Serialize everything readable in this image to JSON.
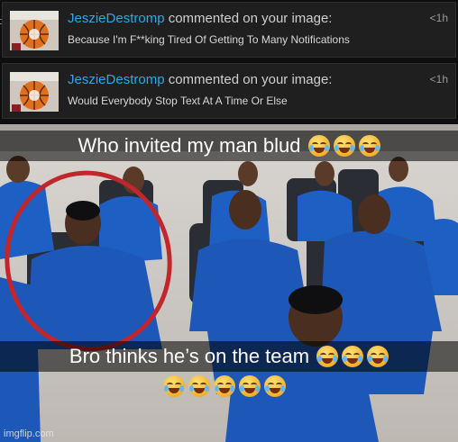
{
  "notifications": [
    {
      "username": "JeszieDestromp",
      "action": " commented on your image:",
      "comment": "Because I'm F**king Tired Of Getting To Many Notifications",
      "time": "<1h"
    },
    {
      "username": "JeszieDestromp",
      "action": " commented on your image:",
      "comment": "Would Everybody Stop Text At A Time Or Else",
      "time": "<1h"
    }
  ],
  "edge_char": "c",
  "photo": {
    "top_caption": "Who invited my man blud",
    "bottom_caption": "Bro thinks he’s on the team",
    "emoji": "crying-face-icon"
  },
  "watermark": "imgflip.com",
  "colors": {
    "username": "#2fa8e8",
    "uniform_blue": "#1e5fc4",
    "circle_red": "#c0262b"
  }
}
